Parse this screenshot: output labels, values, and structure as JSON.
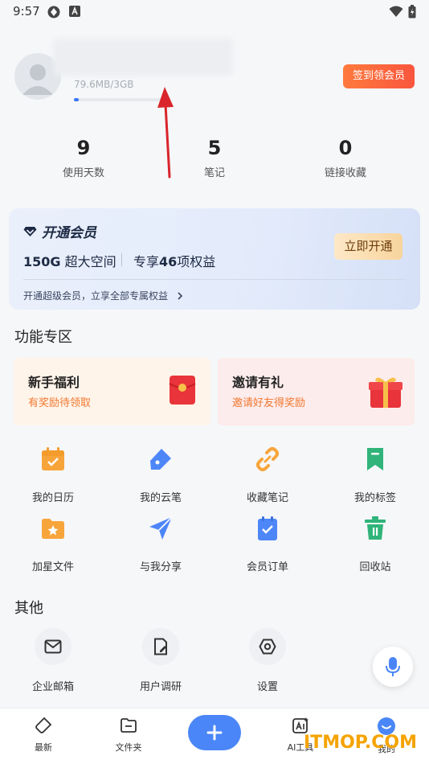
{
  "status_bar": {
    "time": "9:57"
  },
  "profile": {
    "storage_text": "79.6MB/3GB",
    "storage_used_fraction": 0.03,
    "checkin_label": "签到领会员"
  },
  "stats": [
    {
      "value": "9",
      "label": "使用天数"
    },
    {
      "value": "5",
      "label": "笔记"
    },
    {
      "value": "0",
      "label": "链接收藏"
    }
  ],
  "vip": {
    "title": "开通会员",
    "space_bold": "150G",
    "space_text": " 超大空间",
    "rights_prefix": "专享",
    "rights_bold": "46",
    "rights_suffix": "项权益",
    "button": "立即开通",
    "desc": "开通超级会员，立享全部专属权益"
  },
  "features": {
    "section_title": "功能专区",
    "cards": [
      {
        "title": "新手福利",
        "subtitle": "有奖励待领取",
        "bg": "#fff4ea"
      },
      {
        "title": "邀请有礼",
        "subtitle": "邀请好友得奖励",
        "bg": "#fdecec"
      }
    ],
    "grid": [
      {
        "label": "我的日历",
        "icon": "calendar-icon",
        "color": "#f7a53b"
      },
      {
        "label": "我的云笔",
        "icon": "pen-icon",
        "color": "#4d86f7"
      },
      {
        "label": "收藏笔记",
        "icon": "link-icon",
        "color": "#f7a53b"
      },
      {
        "label": "我的标签",
        "icon": "bookmark-icon",
        "color": "#30b47a"
      },
      {
        "label": "加星文件",
        "icon": "star-folder-icon",
        "color": "#f7a53b"
      },
      {
        "label": "与我分享",
        "icon": "send-icon",
        "color": "#4d86f7"
      },
      {
        "label": "会员订单",
        "icon": "order-icon",
        "color": "#4d86f7"
      },
      {
        "label": "回收站",
        "icon": "trash-icon",
        "color": "#30b47a"
      }
    ]
  },
  "others": {
    "section_title": "其他",
    "items": [
      {
        "label": "企业邮箱",
        "icon": "mail-icon"
      },
      {
        "label": "用户调研",
        "icon": "survey-icon"
      },
      {
        "label": "设置",
        "icon": "settings-icon"
      }
    ]
  },
  "bottom_nav": {
    "items": [
      {
        "label": "最新",
        "icon": "tag-icon"
      },
      {
        "label": "文件夹",
        "icon": "folder-icon"
      },
      {
        "label": "AI工具",
        "icon": "ai-icon"
      },
      {
        "label": "我的",
        "icon": "profile-icon"
      }
    ]
  },
  "watermark": "ITMOP.COM",
  "colors": {
    "accent": "#4a86f7",
    "orange": "#f9563e"
  }
}
